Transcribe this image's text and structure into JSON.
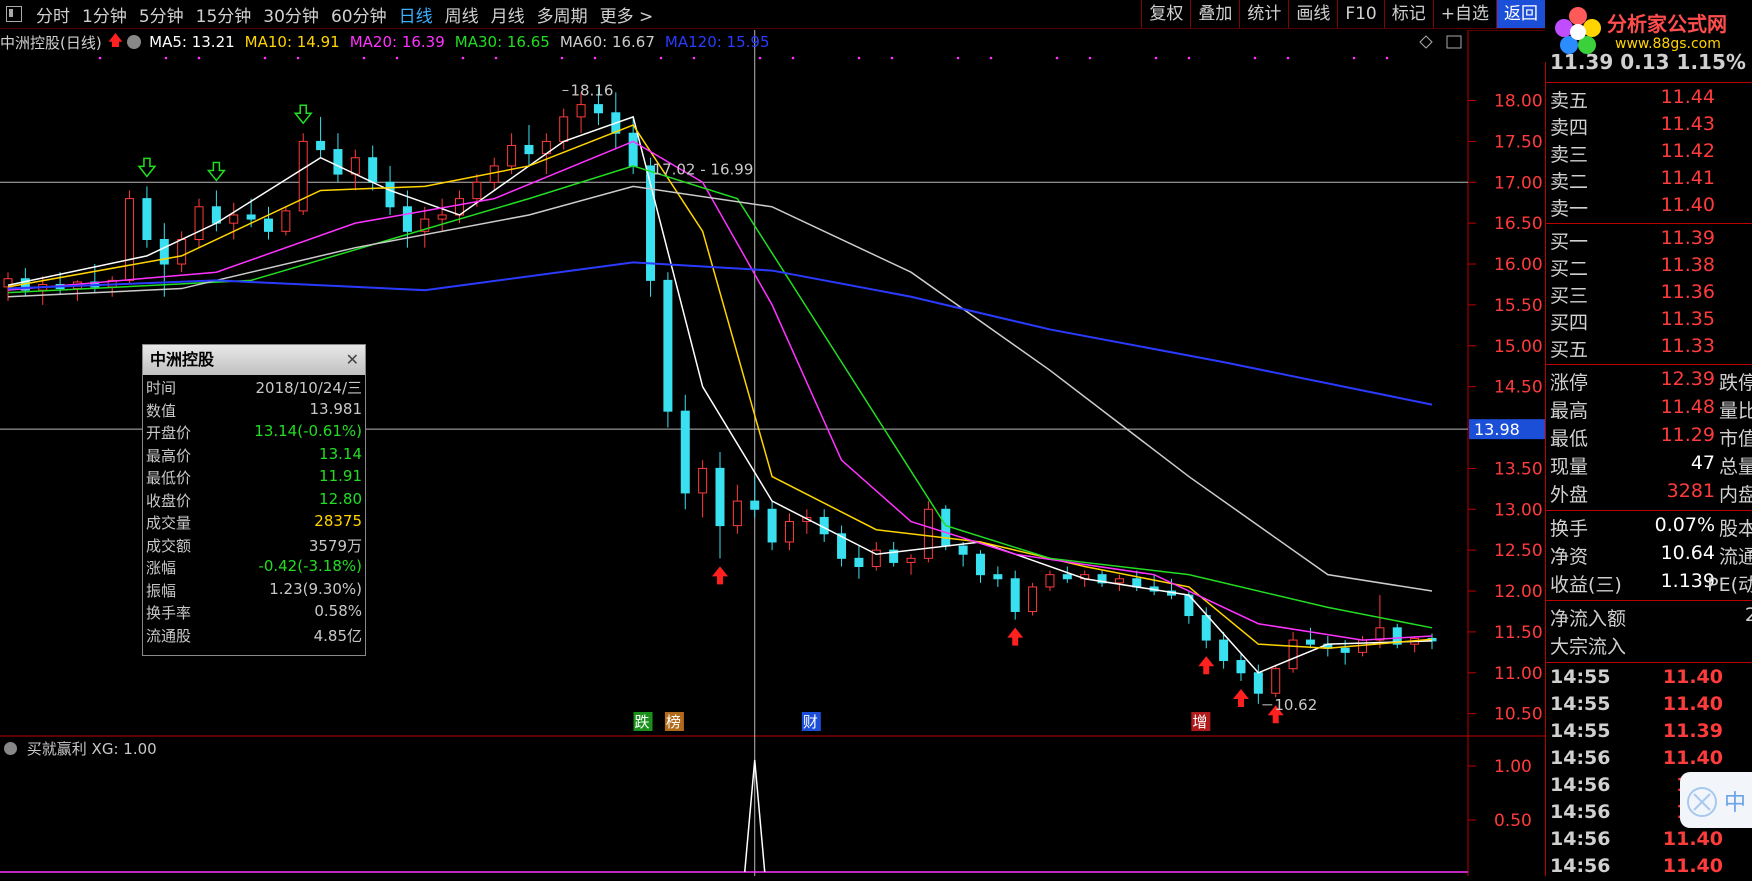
{
  "toolbar": {
    "periods": [
      "分时",
      "1分钟",
      "5分钟",
      "15分钟",
      "30分钟",
      "60分钟",
      "日线",
      "周线",
      "月线",
      "多周期",
      "更多 >"
    ],
    "active_index": 6,
    "right_buttons": [
      "复权",
      "叠加",
      "统计",
      "画线",
      "F10",
      "标记",
      "+自选",
      "返回"
    ]
  },
  "logo": {
    "name": "分析家公式网",
    "url": "www.88gs.com"
  },
  "chart": {
    "title": "中洲控股(日线)",
    "ma": [
      {
        "label": "MA5: 13.21",
        "color": "#ffffff"
      },
      {
        "label": "MA10: 14.91",
        "color": "#ffd400"
      },
      {
        "label": "MA20: 16.39",
        "color": "#ff33ff"
      },
      {
        "label": "MA30: 16.65",
        "color": "#22dd22"
      },
      {
        "label": "MA60: 16.67",
        "color": "#cccccc"
      },
      {
        "label": "MA120: 15.95",
        "color": "#2a3bff"
      }
    ],
    "y_ticks": [
      "18.00",
      "17.50",
      "17.00",
      "16.50",
      "16.00",
      "15.50",
      "15.00",
      "14.50",
      "14.00",
      "13.50",
      "13.00",
      "12.50",
      "12.00",
      "11.50",
      "11.00",
      "10.50"
    ],
    "y_range": [
      10.3,
      18.3
    ],
    "crosshair_value": "13.98",
    "high_label": "18.16",
    "low_label": "10.62",
    "range_label": "17.02 - 16.99",
    "event_markers": [
      "跌",
      "榜",
      "财",
      "增"
    ],
    "candles": [
      [
        15.72,
        15.9,
        15.55,
        15.82
      ],
      [
        15.82,
        15.95,
        15.6,
        15.68
      ],
      [
        15.68,
        15.85,
        15.5,
        15.75
      ],
      [
        15.75,
        15.9,
        15.62,
        15.7
      ],
      [
        15.7,
        15.8,
        15.55,
        15.78
      ],
      [
        15.78,
        16.0,
        15.65,
        15.72
      ],
      [
        15.72,
        15.85,
        15.6,
        15.8
      ],
      [
        15.8,
        16.9,
        15.75,
        16.8
      ],
      [
        16.8,
        16.95,
        16.2,
        16.3
      ],
      [
        16.3,
        16.5,
        15.6,
        16.0
      ],
      [
        16.0,
        16.4,
        15.9,
        16.3
      ],
      [
        16.3,
        16.8,
        16.2,
        16.7
      ],
      [
        16.7,
        16.9,
        16.4,
        16.5
      ],
      [
        16.5,
        16.75,
        16.3,
        16.6
      ],
      [
        16.6,
        16.8,
        16.45,
        16.55
      ],
      [
        16.55,
        16.7,
        16.3,
        16.4
      ],
      [
        16.4,
        16.7,
        16.35,
        16.65
      ],
      [
        16.65,
        17.6,
        16.6,
        17.5
      ],
      [
        17.5,
        17.8,
        17.3,
        17.4
      ],
      [
        17.4,
        17.6,
        17.0,
        17.1
      ],
      [
        17.1,
        17.4,
        16.9,
        17.3
      ],
      [
        17.3,
        17.45,
        16.9,
        17.0
      ],
      [
        17.0,
        17.2,
        16.6,
        16.7
      ],
      [
        16.7,
        16.9,
        16.2,
        16.4
      ],
      [
        16.4,
        16.7,
        16.2,
        16.55
      ],
      [
        16.55,
        16.8,
        16.4,
        16.6
      ],
      [
        16.6,
        16.9,
        16.5,
        16.8
      ],
      [
        16.8,
        17.1,
        16.7,
        17.0
      ],
      [
        17.0,
        17.3,
        16.9,
        17.2
      ],
      [
        17.2,
        17.6,
        17.1,
        17.45
      ],
      [
        17.45,
        17.7,
        17.2,
        17.35
      ],
      [
        17.35,
        17.6,
        17.1,
        17.5
      ],
      [
        17.5,
        17.9,
        17.4,
        17.8
      ],
      [
        17.8,
        18.1,
        17.6,
        17.95
      ],
      [
        17.95,
        18.16,
        17.7,
        17.85
      ],
      [
        17.85,
        18.1,
        17.4,
        17.6
      ],
      [
        17.6,
        17.8,
        17.1,
        17.2
      ],
      [
        17.2,
        17.3,
        15.6,
        15.8
      ],
      [
        15.8,
        15.9,
        14.0,
        14.2
      ],
      [
        14.2,
        14.4,
        13.0,
        13.2
      ],
      [
        13.2,
        13.6,
        12.9,
        13.5
      ],
      [
        13.5,
        13.7,
        12.4,
        12.8
      ],
      [
        12.8,
        13.3,
        12.7,
        13.1
      ],
      [
        13.1,
        13.4,
        12.9,
        13.0
      ],
      [
        13.0,
        13.1,
        12.5,
        12.6
      ],
      [
        12.6,
        12.95,
        12.5,
        12.85
      ],
      [
        12.85,
        13.0,
        12.7,
        12.9
      ],
      [
        12.9,
        13.0,
        12.6,
        12.7
      ],
      [
        12.7,
        12.8,
        12.3,
        12.4
      ],
      [
        12.4,
        12.55,
        12.15,
        12.3
      ],
      [
        12.3,
        12.6,
        12.25,
        12.5
      ],
      [
        12.5,
        12.6,
        12.3,
        12.35
      ],
      [
        12.35,
        12.45,
        12.2,
        12.4
      ],
      [
        12.4,
        13.1,
        12.35,
        13.0
      ],
      [
        13.0,
        13.05,
        12.5,
        12.55
      ],
      [
        12.55,
        12.6,
        12.3,
        12.45
      ],
      [
        12.45,
        12.5,
        12.1,
        12.2
      ],
      [
        12.2,
        12.3,
        12.05,
        12.15
      ],
      [
        12.15,
        12.25,
        11.65,
        11.75
      ],
      [
        11.75,
        12.1,
        11.7,
        12.05
      ],
      [
        12.05,
        12.25,
        12.0,
        12.2
      ],
      [
        12.2,
        12.3,
        12.1,
        12.15
      ],
      [
        12.15,
        12.25,
        12.05,
        12.2
      ],
      [
        12.2,
        12.25,
        12.05,
        12.1
      ],
      [
        12.1,
        12.2,
        12.0,
        12.15
      ],
      [
        12.15,
        12.25,
        12.0,
        12.05
      ],
      [
        12.05,
        12.2,
        11.95,
        12.0
      ],
      [
        12.0,
        12.15,
        11.9,
        11.95
      ],
      [
        11.95,
        12.0,
        11.6,
        11.7
      ],
      [
        11.7,
        11.8,
        11.3,
        11.4
      ],
      [
        11.4,
        11.5,
        11.05,
        11.15
      ],
      [
        11.15,
        11.25,
        10.9,
        11.0
      ],
      [
        11.0,
        11.1,
        10.62,
        10.75
      ],
      [
        10.75,
        11.1,
        10.7,
        11.05
      ],
      [
        11.05,
        11.5,
        11.0,
        11.4
      ],
      [
        11.4,
        11.55,
        11.3,
        11.35
      ],
      [
        11.35,
        11.45,
        11.2,
        11.3
      ],
      [
        11.3,
        11.4,
        11.1,
        11.25
      ],
      [
        11.25,
        11.45,
        11.2,
        11.4
      ],
      [
        11.4,
        11.95,
        11.3,
        11.55
      ],
      [
        11.55,
        11.6,
        11.3,
        11.35
      ],
      [
        11.35,
        11.45,
        11.25,
        11.42
      ],
      [
        11.42,
        11.48,
        11.29,
        11.39
      ]
    ],
    "ma_lines": {
      "ma5": [
        [
          0,
          15.74
        ],
        [
          8,
          16.1
        ],
        [
          12,
          16.5
        ],
        [
          18,
          17.3
        ],
        [
          22,
          16.9
        ],
        [
          26,
          16.6
        ],
        [
          32,
          17.5
        ],
        [
          36,
          17.8
        ],
        [
          40,
          14.5
        ],
        [
          44,
          13.1
        ],
        [
          50,
          12.45
        ],
        [
          56,
          12.6
        ],
        [
          62,
          12.15
        ],
        [
          68,
          11.95
        ],
        [
          72,
          11.0
        ],
        [
          76,
          11.35
        ],
        [
          82,
          11.39
        ]
      ],
      "ma10": [
        [
          0,
          15.72
        ],
        [
          10,
          16.1
        ],
        [
          18,
          16.9
        ],
        [
          24,
          16.95
        ],
        [
          30,
          17.2
        ],
        [
          36,
          17.7
        ],
        [
          40,
          16.4
        ],
        [
          44,
          13.4
        ],
        [
          50,
          12.75
        ],
        [
          56,
          12.6
        ],
        [
          62,
          12.3
        ],
        [
          68,
          12.05
        ],
        [
          72,
          11.35
        ],
        [
          76,
          11.3
        ],
        [
          82,
          11.41
        ]
      ],
      "ma20": [
        [
          0,
          15.68
        ],
        [
          12,
          15.9
        ],
        [
          20,
          16.5
        ],
        [
          28,
          16.8
        ],
        [
          36,
          17.5
        ],
        [
          40,
          17.0
        ],
        [
          44,
          15.5
        ],
        [
          48,
          13.6
        ],
        [
          52,
          12.85
        ],
        [
          58,
          12.45
        ],
        [
          66,
          12.2
        ],
        [
          72,
          11.6
        ],
        [
          78,
          11.4
        ],
        [
          82,
          11.45
        ]
      ],
      "ma30": [
        [
          0,
          15.65
        ],
        [
          14,
          15.8
        ],
        [
          22,
          16.3
        ],
        [
          30,
          16.8
        ],
        [
          36,
          17.2
        ],
        [
          42,
          16.8
        ],
        [
          48,
          14.8
        ],
        [
          54,
          12.8
        ],
        [
          60,
          12.4
        ],
        [
          68,
          12.2
        ],
        [
          76,
          11.8
        ],
        [
          82,
          11.55
        ]
      ],
      "ma60": [
        [
          0,
          15.6
        ],
        [
          10,
          15.7
        ],
        [
          20,
          16.2
        ],
        [
          30,
          16.6
        ],
        [
          36,
          16.95
        ],
        [
          44,
          16.7
        ],
        [
          52,
          15.9
        ],
        [
          60,
          14.7
        ],
        [
          68,
          13.4
        ],
        [
          76,
          12.2
        ],
        [
          82,
          12.0
        ]
      ],
      "ma120": [
        [
          0,
          15.7
        ],
        [
          12,
          15.8
        ],
        [
          24,
          15.68
        ],
        [
          36,
          16.02
        ],
        [
          44,
          15.92
        ],
        [
          52,
          15.6
        ],
        [
          60,
          15.2
        ],
        [
          70,
          14.8
        ],
        [
          82,
          14.28
        ]
      ]
    },
    "buy_arrow_idx": [
      41,
      58,
      69,
      71,
      73
    ],
    "sell_arrow_idx": [
      8,
      12,
      17
    ]
  },
  "tooltip": {
    "title": "中洲控股",
    "rows": [
      {
        "k": "时间",
        "v": "2018/10/24/三",
        "c": "#c8c8c8"
      },
      {
        "k": "数值",
        "v": "13.981",
        "c": "#c8c8c8"
      },
      {
        "k": "开盘价",
        "v": "13.14(-0.61%)",
        "c": "#22dd22"
      },
      {
        "k": "最高价",
        "v": "13.14",
        "c": "#22dd22"
      },
      {
        "k": "最低价",
        "v": "11.91",
        "c": "#22dd22"
      },
      {
        "k": "收盘价",
        "v": "12.80",
        "c": "#22dd22"
      },
      {
        "k": "成交量",
        "v": "28375",
        "c": "#ffd400"
      },
      {
        "k": "成交额",
        "v": "3579万",
        "c": "#c8c8c8"
      },
      {
        "k": "涨幅",
        "v": "-0.42(-3.18%)",
        "c": "#22dd22"
      },
      {
        "k": "振幅",
        "v": "1.23(9.30%)",
        "c": "#c8c8c8"
      },
      {
        "k": "换手率",
        "v": "0.58%",
        "c": "#c8c8c8"
      },
      {
        "k": "流通股",
        "v": "4.85亿",
        "c": "#c8c8c8"
      }
    ]
  },
  "indicator": {
    "label": "买就赢利 XG: 1.00",
    "y_ticks": [
      "1.00",
      "0.50"
    ]
  },
  "quote": {
    "price_line": "11.39  0.13  1.15%",
    "asks": [
      [
        "卖五",
        "11.44"
      ],
      [
        "卖四",
        "11.43"
      ],
      [
        "卖三",
        "11.42"
      ],
      [
        "卖二",
        "11.41"
      ],
      [
        "卖一",
        "11.40"
      ]
    ],
    "bids": [
      [
        "买一",
        "11.39"
      ],
      [
        "买二",
        "11.38"
      ],
      [
        "买三",
        "11.36"
      ],
      [
        "买四",
        "11.35"
      ],
      [
        "买五",
        "11.33"
      ]
    ],
    "stats": [
      {
        "k": "涨停",
        "v": "12.39",
        "c": "#ff3b3b",
        "r": "跌停"
      },
      {
        "k": "最高",
        "v": "11.48",
        "c": "#ff3b3b",
        "r": "量比"
      },
      {
        "k": "最低",
        "v": "11.29",
        "c": "#ff3b3b",
        "r": "市值"
      },
      {
        "k": "现量",
        "v": "47",
        "c": "#ffffff",
        "r": "总量"
      },
      {
        "k": "外盘",
        "v": "3281",
        "c": "#ff3b3b",
        "r": "内盘"
      }
    ],
    "stats2": [
      {
        "k": "换手",
        "v": "0.07%",
        "c": "#ffffff",
        "r": "股本"
      },
      {
        "k": "净资",
        "v": "10.64",
        "c": "#ffffff",
        "r": "流通"
      },
      {
        "k": "收益(三)",
        "v": "1.139",
        "c": "#ffffff",
        "r": "PE(动"
      }
    ],
    "flow": [
      {
        "k": "净流入额",
        "v": "2"
      },
      {
        "k": "大宗流入",
        "v": ""
      }
    ],
    "ticks": [
      [
        "14:55",
        "11.40"
      ],
      [
        "14:55",
        "11.40"
      ],
      [
        "14:55",
        "11.39"
      ],
      [
        "14:56",
        "11.40"
      ],
      [
        "14:56",
        "11.4"
      ],
      [
        "14:56",
        "11.4"
      ],
      [
        "14:56",
        "11.40"
      ],
      [
        "14:56",
        "11.40"
      ]
    ]
  }
}
